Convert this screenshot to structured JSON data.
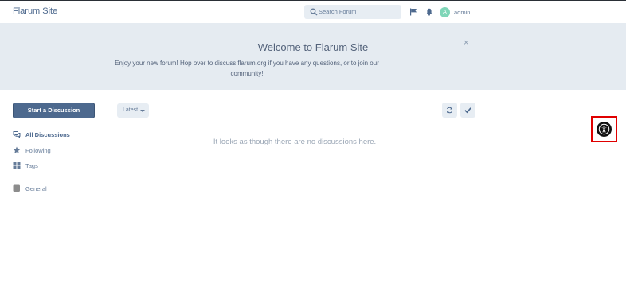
{
  "header": {
    "site_title": "Flarum Site",
    "search_placeholder": "Search Forum",
    "user": {
      "avatar_letter": "A",
      "name": "admin"
    },
    "icons": [
      "flag-icon",
      "bell-icon",
      "search-icon"
    ]
  },
  "hero": {
    "title": "Welcome to Flarum Site",
    "text": "Enjoy your new forum! Hop over to discuss.flarum.org if you have any questions, or to join our community!",
    "close_symbol": "×"
  },
  "sidebar": {
    "start_button": "Start a Discussion",
    "items": [
      {
        "label": "All Discussions",
        "icon": "comments-icon",
        "active": true
      },
      {
        "label": "Following",
        "icon": "star-icon",
        "active": false
      },
      {
        "label": "Tags",
        "icon": "tags-grid-icon",
        "active": false
      },
      {
        "label": "General",
        "icon": "tag-square-icon",
        "active": false
      }
    ]
  },
  "toolbar": {
    "sort_label": "Latest",
    "refresh_icon": "refresh-icon",
    "mark_read_icon": "check-icon"
  },
  "main": {
    "empty_message": "It looks as though there are no discussions here."
  },
  "accessibility": {
    "icon": "accessibility-icon"
  },
  "colors": {
    "primary": "#4d698e",
    "hero_bg": "#e5ebf1",
    "control_bg": "#e7edf3",
    "muted_text": "#9aa6b5",
    "highlight_outline": "#e00000"
  }
}
